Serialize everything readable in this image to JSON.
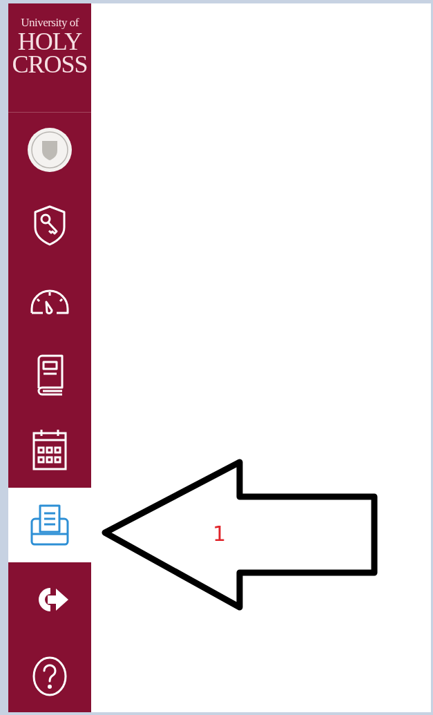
{
  "logo": {
    "lines": [
      "University of",
      "HOLY",
      "CROSS"
    ]
  },
  "nav": {
    "items": [
      {
        "kind": "seal",
        "selected": false
      },
      {
        "kind": "shield-key",
        "selected": false
      },
      {
        "kind": "gauge",
        "selected": false
      },
      {
        "kind": "book",
        "selected": false
      },
      {
        "kind": "calendar",
        "selected": false
      },
      {
        "kind": "printer",
        "selected": true
      },
      {
        "kind": "logout",
        "selected": false
      },
      {
        "kind": "help",
        "selected": false
      }
    ]
  },
  "annotation": {
    "label": "1"
  }
}
